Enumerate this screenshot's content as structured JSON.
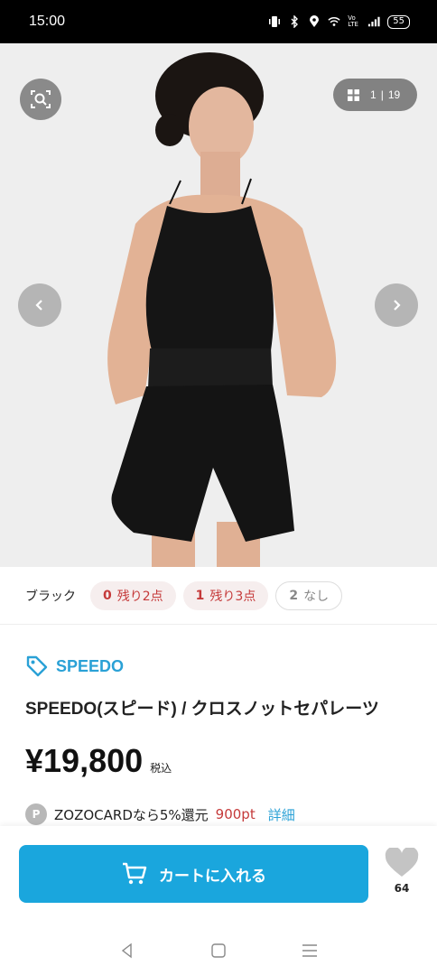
{
  "status_bar": {
    "time": "15:00",
    "battery": "55",
    "icons": [
      "vibrate-icon",
      "bluetooth-icon",
      "location-icon",
      "wifi-icon",
      "volte-icon",
      "signal-icon",
      "battery-icon"
    ],
    "volte": "Vo LTE"
  },
  "gallery": {
    "current": "1",
    "separator": "|",
    "total": "19",
    "bg_color": "#eeeeee"
  },
  "stock": {
    "color_name": "ブラック",
    "sizes": [
      {
        "num": "0",
        "label": "残り2点",
        "state": "low"
      },
      {
        "num": "1",
        "label": "残り3点",
        "state": "low"
      },
      {
        "num": "2",
        "label": "なし",
        "state": "out"
      }
    ]
  },
  "product": {
    "brand": "SPEEDO",
    "title": "SPEEDO(スピード) / クロスノットセパレーツ",
    "price": "¥19,800",
    "tax_label": "税込",
    "points_badge": "P",
    "points_text": "ZOZOCARDなら5%還元",
    "points_amount": "900pt",
    "points_link": "詳細"
  },
  "actions": {
    "cart_label": "カートに入れる",
    "fav_count": "64",
    "accent_color": "#1aa6dd"
  },
  "colors": {
    "brand": "#2aa1d6",
    "stock_red": "#c53a3a"
  }
}
